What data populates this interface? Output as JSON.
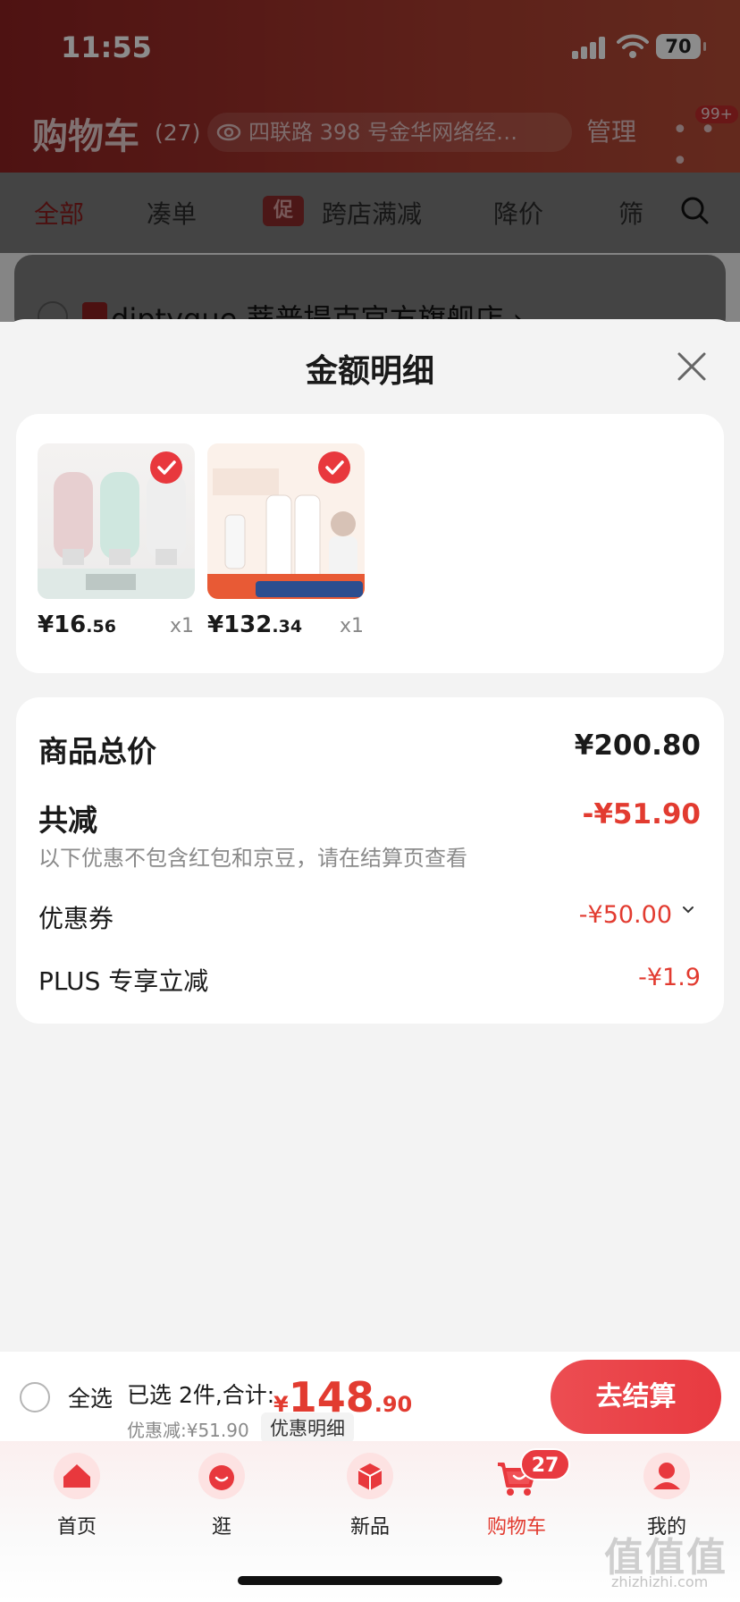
{
  "status_bar": {
    "time": "11:55",
    "battery": "70"
  },
  "header": {
    "title": "购物车",
    "count": "(27)",
    "address": "四联路 398 号金华网络经…",
    "manage": "管理",
    "more_badge": "99+"
  },
  "filters": [
    {
      "label": "全部"
    },
    {
      "label": "凑单"
    },
    {
      "label": "跨店满减",
      "tag": "促"
    },
    {
      "label": "降价"
    },
    {
      "label": "筛"
    }
  ],
  "under_store": "diptyque 蒂普提克官方旗舰店 ›",
  "sheet": {
    "title": "金额明细",
    "items": [
      {
        "price_int": "¥16",
        "price_dec": ".56",
        "qty": "x1"
      },
      {
        "price_int": "¥132",
        "price_dec": ".34",
        "qty": "x1"
      }
    ],
    "summary": {
      "total_label": "商品总价",
      "total_value": "¥200.80",
      "reduce_label": "共减",
      "reduce_value": "-¥51.90",
      "note": "以下优惠不包含红包和京豆，请在结算页查看",
      "coupon_label": "优惠券",
      "coupon_value": "-¥50.00",
      "plus_label": "PLUS 专享立减",
      "plus_value": "-¥1.9"
    }
  },
  "checkout": {
    "select_all": "全选",
    "selected": "已选 2件,合计:",
    "yen": "¥",
    "total_int": "148",
    "total_dec": ".90",
    "discount": "优惠减:¥51.90",
    "detail": "优惠明细",
    "button": "去结算"
  },
  "tabs": [
    {
      "label": "首页",
      "icon": "home-icon"
    },
    {
      "label": "逛",
      "icon": "browse-icon"
    },
    {
      "label": "新品",
      "icon": "new-icon"
    },
    {
      "label": "购物车",
      "icon": "cart-icon",
      "badge": "27"
    },
    {
      "label": "我的",
      "icon": "user-icon"
    }
  ],
  "watermark": {
    "main": "值值值",
    "sub": "zhizhizhi.com"
  },
  "colors": {
    "accent": "#e23b30",
    "button": "#e83a40"
  }
}
